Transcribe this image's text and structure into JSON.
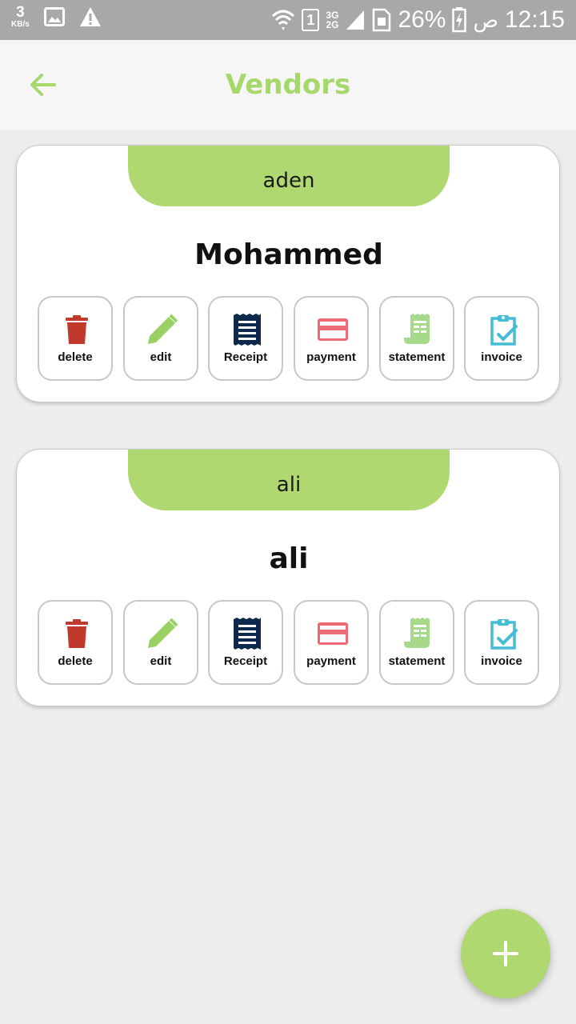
{
  "status_bar": {
    "speed_value": "3",
    "speed_unit": "KB/s",
    "sim_slot": "1",
    "network_top": "3G",
    "network_bottom": "2G",
    "battery": "26%",
    "ampm": "ص",
    "time": "12:15",
    "icons": [
      "image-icon",
      "warning-icon",
      "wifi-icon",
      "sim-icon",
      "signal-icon",
      "battery-charging-icon"
    ]
  },
  "appbar": {
    "title": "Vendors",
    "back_icon": "arrow-left-icon"
  },
  "vendors": [
    {
      "location": "aden",
      "name": "Mohammed",
      "actions": {
        "delete": "delete",
        "edit": "edit",
        "receipt": "Receipt",
        "payment": "payment",
        "statement": "statement",
        "invoice": "invoice"
      }
    },
    {
      "location": "ali",
      "name": "ali",
      "actions": {
        "delete": "delete",
        "edit": "edit",
        "receipt": "Receipt",
        "payment": "payment",
        "statement": "statement",
        "invoice": "invoice"
      }
    }
  ],
  "fab": {
    "icon": "plus-icon"
  },
  "colors": {
    "accent": "#afd970",
    "title": "#a6d86c",
    "delete": "#c0392b",
    "edit": "#9ad062",
    "receipt": "#0d2a4d",
    "payment": "#ee6b76",
    "statement": "#a6d98a",
    "invoice": "#45bcd6"
  }
}
